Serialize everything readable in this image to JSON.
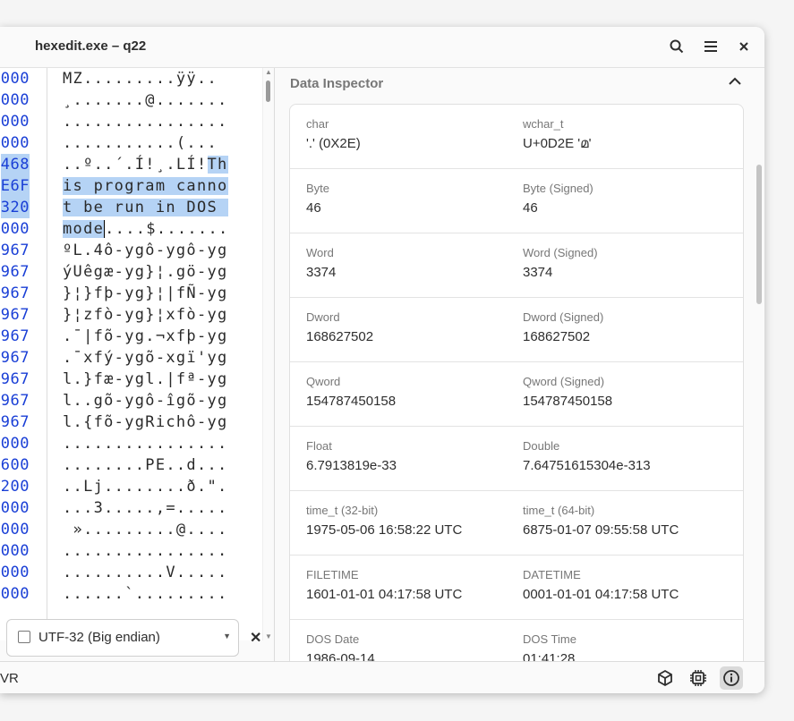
{
  "window": {
    "title": "hexedit.exe – q22"
  },
  "hex": {
    "offsets": [
      "000",
      "000",
      "000",
      "000",
      "468",
      "E6F",
      "320",
      "000",
      "967",
      "967",
      "967",
      "967",
      "967",
      "967",
      "967",
      "967",
      "967",
      "000",
      "600",
      "200",
      "000",
      "000",
      "000",
      "000",
      "000"
    ],
    "ascii_rows": [
      "MZ.........ÿÿ..",
      "¸.......@.......",
      "................",
      "...........(...",
      "..º..´.Í!¸.LÍ!",
      "",
      "",
      "",
      "ºL.4ô-ygô-ygô-yg",
      "ýUêgæ-yg}¦.gö-yg",
      "}¦}fþ-yg}¦|fÑ-yg",
      "}¦zfò-yg}¦xfò-yg",
      ".¯|fõ-yg.¬xfþ-yg",
      ".¯xfý-ygõ-xgï'yg",
      "l.}fæ-ygl.|fª-yg",
      "l..gõ-ygô-îgõ-yg",
      "l.{fõ-ygRichô-yg",
      "................",
      "........PE..d...",
      "..Lj........ð.\".",
      "...3.....,=.....",
      " ».........@....",
      "................",
      "..........V.....",
      "......`........."
    ],
    "row4_hl": "Th",
    "row5": "is program canno",
    "row6": "t be run in DOS ",
    "row7_hl": "mode",
    "row7_rest": "....$.......",
    "encoding": "UTF-32 (Big endian)"
  },
  "status": {
    "text": "VR"
  },
  "inspector": {
    "title": "Data Inspector",
    "rows": [
      {
        "l_label": "char",
        "l_value": "'.' (0X2E)",
        "r_label": "wchar_t",
        "r_value": "U+0D2E 'മ'"
      },
      {
        "l_label": "Byte",
        "l_value": "46",
        "r_label": "Byte (Signed)",
        "r_value": "46"
      },
      {
        "l_label": "Word",
        "l_value": "3374",
        "r_label": "Word (Signed)",
        "r_value": "3374"
      },
      {
        "l_label": "Dword",
        "l_value": "168627502",
        "r_label": "Dword (Signed)",
        "r_value": "168627502"
      },
      {
        "l_label": "Qword",
        "l_value": "154787450158",
        "r_label": "Qword (Signed)",
        "r_value": "154787450158"
      },
      {
        "l_label": "Float",
        "l_value": "6.7913819e-33",
        "r_label": "Double",
        "r_value": "7.64751615304e-313"
      },
      {
        "l_label": "time_t (32-bit)",
        "l_value": "1975-05-06 16:58:22 UTC",
        "r_label": "time_t (64-bit)",
        "r_value": "6875-01-07 09:55:58 UTC"
      },
      {
        "l_label": "FILETIME",
        "l_value": "1601-01-01 04:17:58 UTC",
        "r_label": "DATETIME",
        "r_value": "0001-01-01 04:17:58 UTC"
      },
      {
        "l_label": "DOS Date",
        "l_value": "1986-09-14",
        "r_label": "DOS Time",
        "r_value": "01:41:28"
      }
    ]
  },
  "icons": {
    "search": "search-icon",
    "menu": "hamburger-menu-icon",
    "close": "close-icon",
    "encoding": "character-encoding-icon",
    "package": "package-icon",
    "chip": "chip-icon",
    "info": "info-icon"
  }
}
